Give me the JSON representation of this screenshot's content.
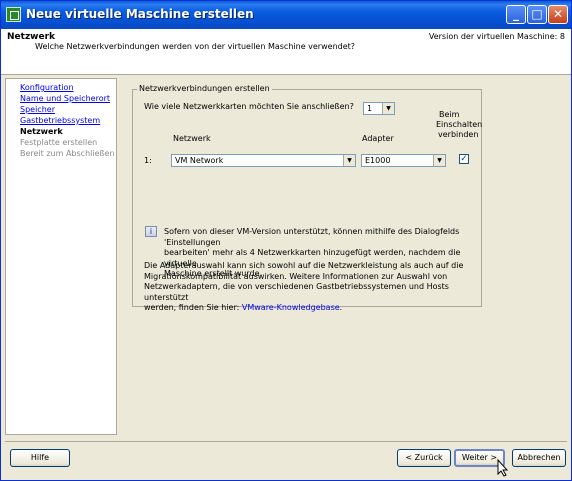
{
  "window": {
    "title": "Neue virtuelle Maschine erstellen",
    "minimize": "_",
    "maximize": "□",
    "close": "✕"
  },
  "header": {
    "title": "Netzwerk",
    "subtitle": "Welche Netzwerkverbindungen werden von der virtuellen Maschine verwendet?",
    "version": "Version der virtuellen Maschine: 8"
  },
  "nav": {
    "items": [
      {
        "label": "Konfiguration"
      },
      {
        "label": "Name und Speicherort"
      },
      {
        "label": "Speicher"
      },
      {
        "label": "Gastbetriebssystem"
      },
      {
        "label": "Netzwerk"
      },
      {
        "label": "Festplatte erstellen"
      },
      {
        "label": "Bereit zum Abschließen"
      }
    ]
  },
  "group": {
    "legend": "Netzwerkverbindungen erstellen",
    "question": "Wie viele Netzwerkkarten möchten Sie anschließen?",
    "nic_count": "1",
    "col_network": "Netzwerk",
    "col_adapter": "Adapter",
    "col_connect": [
      "Beim",
      "Einschalten",
      "verbinden"
    ],
    "rows": [
      {
        "index": "1:",
        "network": "VM Network",
        "adapter": "E1000",
        "connect": "✓"
      }
    ],
    "info1": [
      "Sofern von dieser VM-Version unterstützt, können mithilfe des Dialogfelds 'Einstellungen",
      "bearbeiten' mehr als 4 Netzwerkkarten hinzugefügt werden, nachdem die virtuelle",
      "Maschine erstellt wurde."
    ],
    "info2": [
      "Die Adapterauswahl kann sich sowohl auf die Netzwerkleistung als auch auf die",
      "Migrationskompatibilität auswirken. Weitere Informationen zur Auswahl von",
      "Netzwerkadaptern, die von verschiedenen Gastbetriebssystemen und Hosts unterstützt",
      "werden, finden Sie hier:"
    ],
    "kb_link": "VMware-Knowledgebase",
    "kb_suffix": "."
  },
  "footer": {
    "help": "Hilfe",
    "back": "< Zurück",
    "next": "Weiter >",
    "cancel": "Abbrechen"
  }
}
